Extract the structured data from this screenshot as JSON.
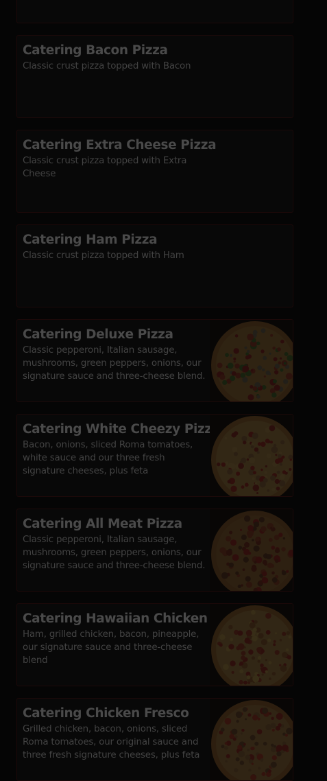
{
  "menu": {
    "items": [
      {
        "title": "",
        "description": "",
        "image": null
      },
      {
        "title": "Catering Bacon Pizza",
        "description": "Classic crust pizza topped with Bacon",
        "image": null
      },
      {
        "title": "Catering Extra Cheese Pizza",
        "description": "Classic crust pizza topped with Extra Cheese",
        "image": null
      },
      {
        "title": "Catering Ham Pizza",
        "description": "Classic crust pizza topped with Ham",
        "image": null
      },
      {
        "title": "Catering Deluxe Pizza",
        "description": "Classic pepperoni, Italian sausage, mushrooms, green peppers, onions, our signature sauce and three-cheese blend.",
        "image": "deluxe-pizza-photo"
      },
      {
        "title": "Catering White Cheezy Pizza",
        "description": "Bacon, onions, sliced Roma tomatoes, white sauce and our three fresh signature cheeses, plus feta",
        "image": "white-cheezy-pizza-photo"
      },
      {
        "title": "Catering All Meat Pizza",
        "description": "Classic pepperoni, Italian sausage, mushrooms, green peppers, onions, our signature sauce and three-cheese blend.",
        "image": "all-meat-pizza-photo"
      },
      {
        "title": "Catering Hawaiian Chicken",
        "description": "Ham, grilled chicken, bacon, pineapple, our signature sauce and three-cheese blend",
        "image": "hawaiian-chicken-pizza-photo"
      },
      {
        "title": "Catering Chicken Fresco",
        "description": "Grilled chicken, bacon, onions, sliced Roma tomatoes, our original sauce and three fresh signature cheeses, plus feta",
        "image": "chicken-fresco-pizza-photo"
      }
    ]
  },
  "colors": {
    "background": "#050505",
    "card_border": "#1c0909",
    "title_text": "#4a4a4a",
    "description_text": "#434343"
  }
}
